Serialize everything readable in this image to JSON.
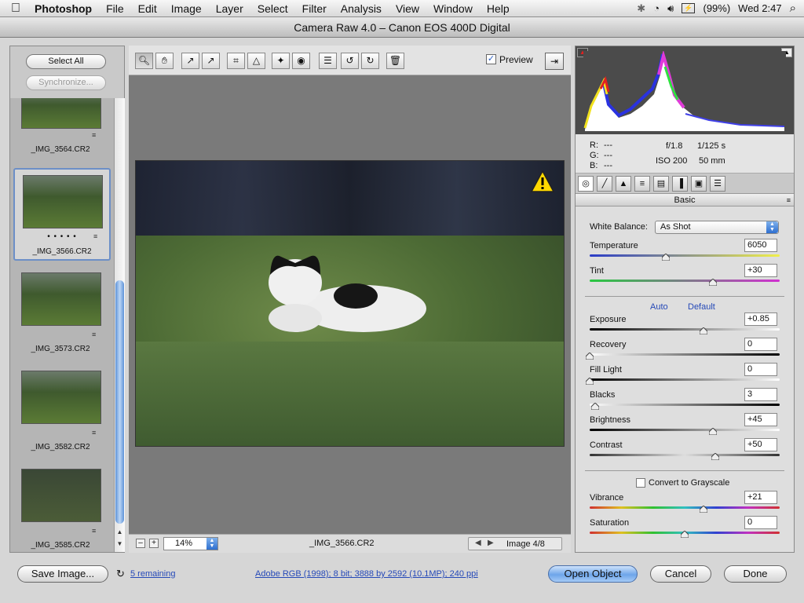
{
  "menubar": {
    "app": "Photoshop",
    "items": [
      "File",
      "Edit",
      "Image",
      "Layer",
      "Select",
      "Filter",
      "Analysis",
      "View",
      "Window",
      "Help"
    ],
    "battery": "(99%)",
    "clock": "Wed 2:47"
  },
  "window": {
    "title": "Camera Raw 4.0  –  Canon EOS 400D Digital"
  },
  "filmstrip": {
    "select_all": "Select All",
    "synchronize": "Synchronize...",
    "thumbnails": [
      {
        "name": "_IMG_3564.CR2"
      },
      {
        "name": "_IMG_3566.CR2",
        "rating": "• • • • •"
      },
      {
        "name": "_IMG_3573.CR2"
      },
      {
        "name": "_IMG_3582.CR2"
      },
      {
        "name": "_IMG_3585.CR2"
      }
    ]
  },
  "toolbar": {
    "preview_label": "Preview",
    "preview_checked": "✓"
  },
  "status": {
    "zoom": "14%",
    "filename": "_IMG_3566.CR2",
    "image_counter": "Image 4/8"
  },
  "info": {
    "r": "R:",
    "g": "G:",
    "b": "B:",
    "dash": "---",
    "aperture": "f/1.8",
    "shutter": "1/125 s",
    "iso": "ISO 200",
    "focal": "50 mm"
  },
  "panel": {
    "section": "Basic",
    "white_balance_label": "White Balance:",
    "white_balance_value": "As Shot",
    "auto": "Auto",
    "default": "Default",
    "grayscale_label": "Convert to Grayscale",
    "sliders": [
      {
        "label": "Temperature",
        "value": "6050",
        "pos": 0.4
      },
      {
        "label": "Tint",
        "value": "+30",
        "pos": 0.65
      },
      {
        "label": "Exposure",
        "value": "+0.85",
        "pos": 0.6
      },
      {
        "label": "Recovery",
        "value": "0",
        "pos": 0.0
      },
      {
        "label": "Fill Light",
        "value": "0",
        "pos": 0.0
      },
      {
        "label": "Blacks",
        "value": "3",
        "pos": 0.03
      },
      {
        "label": "Brightness",
        "value": "+45",
        "pos": 0.65
      },
      {
        "label": "Contrast",
        "value": "+50",
        "pos": 0.66
      },
      {
        "label": "Vibrance",
        "value": "+21",
        "pos": 0.6
      },
      {
        "label": "Saturation",
        "value": "0",
        "pos": 0.5
      }
    ]
  },
  "bottom": {
    "save": "Save Image...",
    "remaining": "5 remaining",
    "workflow": "Adobe RGB (1998); 8 bit; 3888 by 2592 (10.1MP); 240 ppi",
    "open": "Open Object",
    "cancel": "Cancel",
    "done": "Done"
  }
}
